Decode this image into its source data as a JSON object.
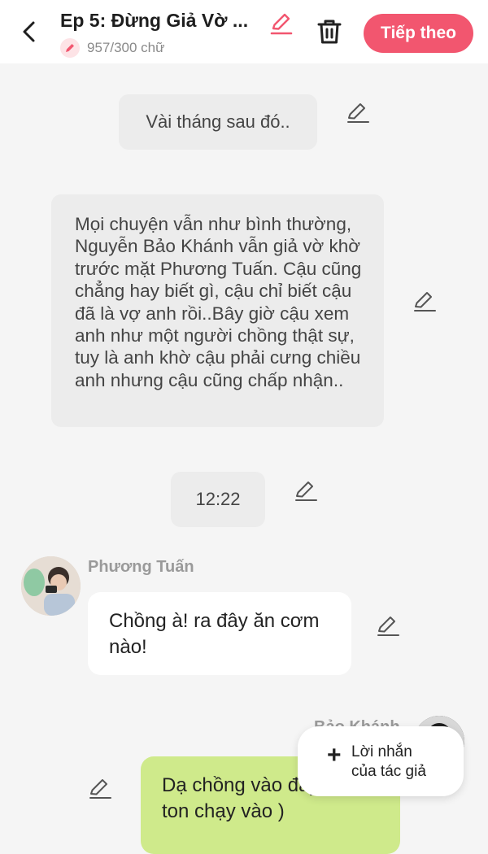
{
  "header": {
    "title": "Ep 5: Đừng Giả Vờ ...",
    "word_count": "957/300 chữ",
    "next_label": "Tiếp theo",
    "accent_color": "#f2566f"
  },
  "messages": {
    "narration_1": "Vài tháng sau đó..",
    "narration_2": "Mọi chuyện vẫn như bình thường, Nguyễn Bảo Khánh vẫn giả vờ khờ trước mặt Phương Tuấn. Cậu cũng chẳng hay biết gì, cậu chỉ biết cậu đã là vợ anh rồi..Bây giờ cậu xem anh như một người chồng thật sự, tuy là anh khờ cậu phải cưng chiều anh nhưng cậu cũng chấp nhận..",
    "timestamp": "12:22",
    "left_name": "Phương Tuấn",
    "left_text": "Chồng à! ra đây ăn cơm nào!",
    "right_name": "Bảo Khánh",
    "right_text": "Dạ chồng vào đây ( lon ton chạy vào )"
  },
  "author_note": {
    "label": "Lời nhắn của tác giả"
  },
  "icons": {
    "back": "chevron-left-icon",
    "edit": "pencil-icon",
    "trash": "trash-icon",
    "plus": "plus-icon"
  }
}
